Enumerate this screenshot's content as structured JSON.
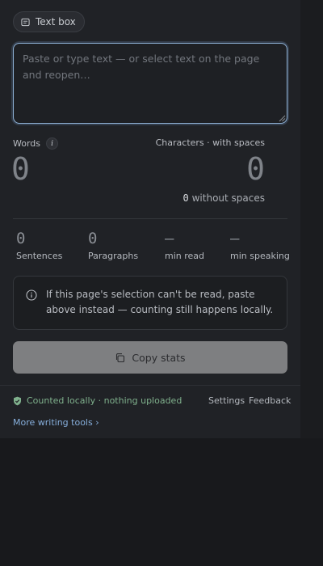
{
  "source_chip": {
    "label": "Text box",
    "icon": "text-box-icon"
  },
  "input": {
    "value": "",
    "placeholder": "Paste or type text — or select text on the page and reopen…"
  },
  "counts": {
    "words_label": "Words",
    "words_info_glyph": "i",
    "words_value": "0",
    "characters_label": "Characters · with spaces",
    "characters_value": "0",
    "without_spaces_value": "0",
    "without_spaces_label": "without spaces"
  },
  "stats": [
    {
      "value": "0",
      "label": "Sentences"
    },
    {
      "value": "0",
      "label": "Paragraphs"
    },
    {
      "value": "—",
      "label": "min read"
    },
    {
      "value": "—",
      "label": "min speaking"
    }
  ],
  "notice": {
    "icon": "info-icon",
    "text": "If this page's selection can't be read, paste above instead — counting still happens locally."
  },
  "copy_button": {
    "label": "Copy stats",
    "icon": "copy-icon"
  },
  "footer": {
    "privacy_text": "Counted locally · nothing uploaded",
    "privacy_icon": "shield-check-icon",
    "settings_label": "Settings",
    "feedback_label": "Feedback",
    "more_tools_label": "More writing tools ›"
  },
  "colors": {
    "background": "#202226",
    "focus_ring": "#8fb2d6",
    "privacy_green": "#7fb08c",
    "link_blue": "#86aedb",
    "copy_button_bg": "#7e7f81"
  }
}
